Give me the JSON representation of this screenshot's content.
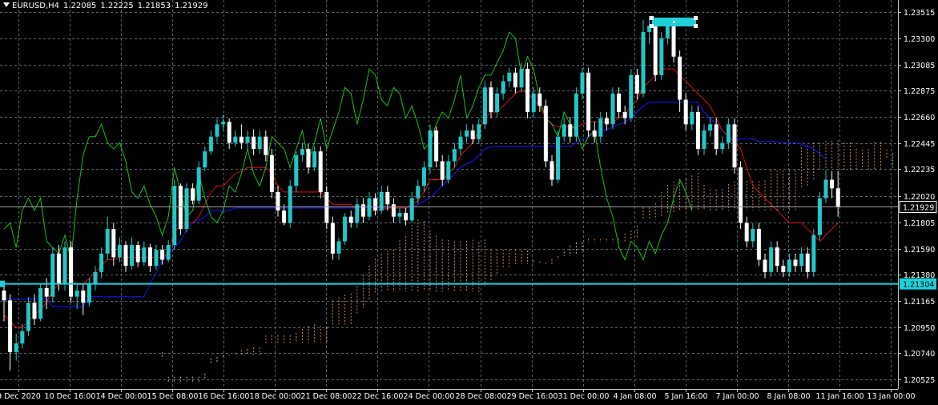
{
  "header": {
    "symbol": "EURUSD,H4",
    "open": "1.22085",
    "high": "1.22225",
    "low": "1.21853",
    "close": "1.21929"
  },
  "colors": {
    "background": "#000000",
    "grid": "#5a6670",
    "bull": "#22c8c8",
    "bear": "#ffffff",
    "tenkan": "#e01010",
    "kijun": "#1818ff",
    "chikou": "#19c419",
    "cloud_up": "#f4a460",
    "cloud_down": "#ded8c8",
    "hline": "#20d0d8",
    "price_line": "#a0a0a0"
  },
  "chart_data": {
    "type": "candlestick",
    "symbol": "EURUSD",
    "timeframe": "H4",
    "ylim": [
      1.2045,
      1.2361
    ],
    "y_ticks": [
      "1.23515",
      "1.23300",
      "1.23085",
      "1.22875",
      "1.22660",
      "1.22445",
      "1.22235",
      "1.22020",
      "1.21805",
      "1.21590",
      "1.21380",
      "1.21165",
      "1.20950",
      "1.20740",
      "1.20525"
    ],
    "x_ticks": [
      "9 Dec 2020",
      "10 Dec 16:00",
      "14 Dec 00:00",
      "15 Dec 08:00",
      "16 Dec 16:00",
      "18 Dec 00:00",
      "21 Dec 08:00",
      "22 Dec 16:00",
      "24 Dec 00:00",
      "28 Dec 08:00",
      "29 Dec 16:00",
      "31 Dec 00:00",
      "4 Jan 08:00",
      "5 Jan 16:00",
      "7 Jan 00:00",
      "8 Jan 08:00",
      "11 Jan 16:00",
      "13 Jan 00:00"
    ],
    "price_label": "1.21929",
    "hline_label": "1.21304",
    "hline_value": 1.21304,
    "current_price": 1.21929,
    "candles": [
      [
        1.2125,
        1.2117,
        1.213,
        1.21
      ],
      [
        1.2117,
        1.2075,
        1.2122,
        1.206
      ],
      [
        1.2075,
        1.2082,
        1.209,
        1.2068
      ],
      [
        1.2082,
        1.2092,
        1.2098,
        1.2078
      ],
      [
        1.2092,
        1.2115,
        1.212,
        1.2088
      ],
      [
        1.2115,
        1.2102,
        1.2122,
        1.2097
      ],
      [
        1.2102,
        1.2127,
        1.213,
        1.21
      ],
      [
        1.2127,
        1.212,
        1.2135,
        1.211
      ],
      [
        1.212,
        1.2155,
        1.216,
        1.2115
      ],
      [
        1.2155,
        1.213,
        1.2162,
        1.2125
      ],
      [
        1.213,
        1.216,
        1.2165,
        1.2125
      ],
      [
        1.216,
        1.212,
        1.2165,
        1.2115
      ],
      [
        1.212,
        1.2125,
        1.213,
        1.211
      ],
      [
        1.2125,
        1.2115,
        1.213,
        1.2105
      ],
      [
        1.2115,
        1.213,
        1.2135,
        1.2112
      ],
      [
        1.213,
        1.214,
        1.2145,
        1.2125
      ],
      [
        1.214,
        1.2155,
        1.216,
        1.2135
      ],
      [
        1.2155,
        1.2175,
        1.2185,
        1.215
      ],
      [
        1.2175,
        1.2152,
        1.218,
        1.2145
      ],
      [
        1.2152,
        1.2162,
        1.2168,
        1.2148
      ],
      [
        1.2162,
        1.2145,
        1.2165,
        1.214
      ],
      [
        1.2145,
        1.2162,
        1.2168,
        1.2142
      ],
      [
        1.2162,
        1.2148,
        1.2165,
        1.2144
      ],
      [
        1.2148,
        1.216,
        1.2165,
        1.2145
      ],
      [
        1.216,
        1.2145,
        1.2163,
        1.214
      ],
      [
        1.2145,
        1.2158,
        1.2162,
        1.2142
      ],
      [
        1.2158,
        1.215,
        1.2162,
        1.2146
      ],
      [
        1.215,
        1.2162,
        1.2166,
        1.2148
      ],
      [
        1.2162,
        1.221,
        1.2215,
        1.2158
      ],
      [
        1.221,
        1.2175,
        1.2212,
        1.217
      ],
      [
        1.2175,
        1.2208,
        1.2212,
        1.2172
      ],
      [
        1.2208,
        1.2198,
        1.2212,
        1.2195
      ],
      [
        1.2198,
        1.2225,
        1.223,
        1.2195
      ],
      [
        1.2225,
        1.2238,
        1.2242,
        1.2222
      ],
      [
        1.2238,
        1.225,
        1.2255,
        1.2235
      ],
      [
        1.225,
        1.226,
        1.2265,
        1.2245
      ],
      [
        1.226,
        1.2262,
        1.2268,
        1.2255
      ],
      [
        1.2262,
        1.2245,
        1.2265,
        1.224
      ],
      [
        1.2245,
        1.225,
        1.2255,
        1.2242
      ],
      [
        1.225,
        1.2245,
        1.226,
        1.224
      ],
      [
        1.2245,
        1.225,
        1.2255,
        1.224
      ],
      [
        1.225,
        1.224,
        1.2256,
        1.2235
      ],
      [
        1.224,
        1.225,
        1.2255,
        1.2236
      ],
      [
        1.225,
        1.2235,
        1.2255,
        1.223
      ],
      [
        1.2235,
        1.2205,
        1.224,
        1.22
      ],
      [
        1.2205,
        1.219,
        1.221,
        1.2185
      ],
      [
        1.219,
        1.218,
        1.2195,
        1.2178
      ],
      [
        1.218,
        1.221,
        1.2215,
        1.2176
      ],
      [
        1.221,
        1.2235,
        1.2238,
        1.2205
      ],
      [
        1.2235,
        1.224,
        1.2245,
        1.223
      ],
      [
        1.224,
        1.2225,
        1.2244,
        1.222
      ],
      [
        1.2225,
        1.2238,
        1.2242,
        1.2222
      ],
      [
        1.2238,
        1.2205,
        1.2242,
        1.22
      ],
      [
        1.2205,
        1.218,
        1.221,
        1.2175
      ],
      [
        1.218,
        1.2155,
        1.2185,
        1.215
      ],
      [
        1.2155,
        1.2165,
        1.2168,
        1.215
      ],
      [
        1.2165,
        1.2185,
        1.2188,
        1.2162
      ],
      [
        1.2185,
        1.218,
        1.219,
        1.2176
      ],
      [
        1.218,
        1.2195,
        1.22,
        1.2176
      ],
      [
        1.2195,
        1.2185,
        1.22,
        1.218
      ],
      [
        1.2185,
        1.22,
        1.2205,
        1.2182
      ],
      [
        1.22,
        1.219,
        1.2204,
        1.2186
      ],
      [
        1.219,
        1.2205,
        1.221,
        1.2187
      ],
      [
        1.2205,
        1.2195,
        1.221,
        1.219
      ],
      [
        1.2195,
        1.2185,
        1.22,
        1.218
      ],
      [
        1.2185,
        1.2188,
        1.2192,
        1.218
      ],
      [
        1.2188,
        1.2182,
        1.2192,
        1.2178
      ],
      [
        1.2182,
        1.22,
        1.2205,
        1.218
      ],
      [
        1.22,
        1.221,
        1.2215,
        1.2196
      ],
      [
        1.221,
        1.2225,
        1.223,
        1.2205
      ],
      [
        1.2225,
        1.2255,
        1.226,
        1.222
      ],
      [
        1.2255,
        1.223,
        1.2258,
        1.2225
      ],
      [
        1.223,
        1.2215,
        1.2235,
        1.221
      ],
      [
        1.2215,
        1.223,
        1.2235,
        1.2212
      ],
      [
        1.223,
        1.224,
        1.2245,
        1.2225
      ],
      [
        1.224,
        1.225,
        1.2255,
        1.2235
      ],
      [
        1.225,
        1.2255,
        1.226,
        1.2245
      ],
      [
        1.2255,
        1.2248,
        1.226,
        1.2244
      ],
      [
        1.2248,
        1.226,
        1.2265,
        1.2244
      ],
      [
        1.226,
        1.229,
        1.2295,
        1.2256
      ],
      [
        1.229,
        1.227,
        1.2295,
        1.2265
      ],
      [
        1.227,
        1.2285,
        1.229,
        1.2266
      ],
      [
        1.2285,
        1.2295,
        1.23,
        1.228
      ],
      [
        1.2295,
        1.2302,
        1.2306,
        1.229
      ],
      [
        1.2302,
        1.229,
        1.2306,
        1.2285
      ],
      [
        1.229,
        1.2305,
        1.231,
        1.2286
      ],
      [
        1.2305,
        1.227,
        1.231,
        1.2265
      ],
      [
        1.227,
        1.2285,
        1.229,
        1.2266
      ],
      [
        1.2285,
        1.2275,
        1.229,
        1.227
      ],
      [
        1.2275,
        1.223,
        1.228,
        1.2225
      ],
      [
        1.223,
        1.2215,
        1.2235,
        1.221
      ],
      [
        1.2215,
        1.225,
        1.2255,
        1.2212
      ],
      [
        1.225,
        1.226,
        1.2265,
        1.2246
      ],
      [
        1.226,
        1.225,
        1.2266,
        1.2245
      ],
      [
        1.225,
        1.2285,
        1.229,
        1.2246
      ],
      [
        1.2285,
        1.2302,
        1.2306,
        1.228
      ],
      [
        1.2302,
        1.2255,
        1.2306,
        1.225
      ],
      [
        1.2255,
        1.225,
        1.2262,
        1.2245
      ],
      [
        1.225,
        1.2265,
        1.227,
        1.2245
      ],
      [
        1.2265,
        1.226,
        1.227,
        1.2255
      ],
      [
        1.226,
        1.2285,
        1.229,
        1.2256
      ],
      [
        1.2285,
        1.227,
        1.229,
        1.2265
      ],
      [
        1.227,
        1.2265,
        1.2275,
        1.226
      ],
      [
        1.2265,
        1.23,
        1.2305,
        1.2262
      ],
      [
        1.23,
        1.2285,
        1.2305,
        1.228
      ],
      [
        1.2285,
        1.2335,
        1.2345,
        1.2282
      ],
      [
        1.2335,
        1.234,
        1.2348,
        1.2325
      ],
      [
        1.234,
        1.23,
        1.2345,
        1.2295
      ],
      [
        1.23,
        1.233,
        1.2335,
        1.2296
      ],
      [
        1.233,
        1.234,
        1.2345,
        1.2325
      ],
      [
        1.234,
        1.2315,
        1.2345,
        1.231
      ],
      [
        1.2315,
        1.228,
        1.232,
        1.227
      ],
      [
        1.228,
        1.226,
        1.2285,
        1.2255
      ],
      [
        1.226,
        1.227,
        1.2275,
        1.2255
      ],
      [
        1.227,
        1.224,
        1.2275,
        1.2235
      ],
      [
        1.224,
        1.2255,
        1.226,
        1.2235
      ],
      [
        1.2255,
        1.226,
        1.2266,
        1.225
      ],
      [
        1.226,
        1.224,
        1.2265,
        1.2235
      ],
      [
        1.224,
        1.2245,
        1.225,
        1.2236
      ],
      [
        1.2245,
        1.226,
        1.2265,
        1.224
      ],
      [
        1.226,
        1.2225,
        1.2265,
        1.222
      ],
      [
        1.2225,
        1.218,
        1.223,
        1.2175
      ],
      [
        1.218,
        1.2165,
        1.2185,
        1.216
      ],
      [
        1.2165,
        1.2175,
        1.218,
        1.216
      ],
      [
        1.2175,
        1.215,
        1.218,
        1.2145
      ],
      [
        1.215,
        1.214,
        1.2155,
        1.2135
      ],
      [
        1.214,
        1.216,
        1.2165,
        1.2136
      ],
      [
        1.216,
        1.2145,
        1.2165,
        1.214
      ],
      [
        1.2145,
        1.214,
        1.215,
        1.2136
      ],
      [
        1.214,
        1.215,
        1.2155,
        1.2136
      ],
      [
        1.215,
        1.2145,
        1.2155,
        1.214
      ],
      [
        1.2145,
        1.2155,
        1.216,
        1.214
      ],
      [
        1.2155,
        1.214,
        1.216,
        1.2135
      ],
      [
        1.214,
        1.217,
        1.2175,
        1.2136
      ],
      [
        1.217,
        1.22,
        1.2205,
        1.2166
      ],
      [
        1.22,
        1.2215,
        1.2222,
        1.2196
      ],
      [
        1.2215,
        1.2208,
        1.2222,
        1.22
      ],
      [
        1.2208,
        1.2193,
        1.2222,
        1.2185
      ]
    ],
    "tenkan": [
      1.2105,
      1.21,
      1.2095,
      1.2095,
      1.21,
      1.2105,
      1.211,
      1.2115,
      1.2125,
      1.213,
      1.2135,
      1.2135,
      1.213,
      1.213,
      1.2135,
      1.214,
      1.2145,
      1.215,
      1.215,
      1.2152,
      1.2152,
      1.2152,
      1.2152,
      1.2152,
      1.2152,
      1.2152,
      1.2152,
      1.2155,
      1.2175,
      1.2175,
      1.218,
      1.218,
      1.2185,
      1.2195,
      1.2205,
      1.221,
      1.221,
      1.2215,
      1.222,
      1.2222,
      1.2225,
      1.2225,
      1.2225,
      1.2225,
      1.222,
      1.221,
      1.2205,
      1.2205,
      1.2205,
      1.2205,
      1.2205,
      1.2205,
      1.2205,
      1.22,
      1.2195,
      1.2195,
      1.2195,
      1.2195,
      1.219,
      1.219,
      1.219,
      1.219,
      1.219,
      1.2192,
      1.2192,
      1.2192,
      1.2192,
      1.2195,
      1.2198,
      1.2205,
      1.2215,
      1.2215,
      1.2215,
      1.222,
      1.2225,
      1.2235,
      1.224,
      1.2245,
      1.2255,
      1.2265,
      1.227,
      1.227,
      1.2275,
      1.228,
      1.2285,
      1.2288,
      1.2285,
      1.228,
      1.2275,
      1.2265,
      1.226,
      1.2258,
      1.2258,
      1.2258,
      1.2258,
      1.226,
      1.2262,
      1.2262,
      1.2262,
      1.2262,
      1.2262,
      1.2265,
      1.2268,
      1.2275,
      1.228,
      1.229,
      1.2295,
      1.23,
      1.2305,
      1.2305,
      1.2305,
      1.23,
      1.2295,
      1.229,
      1.2285,
      1.228,
      1.2275,
      1.2265,
      1.2255,
      1.225,
      1.2245,
      1.224,
      1.2225,
      1.221,
      1.2205,
      1.22,
      1.2195,
      1.219,
      1.2185,
      1.218,
      1.218,
      1.218,
      1.2175,
      1.217,
      1.2165,
      1.217,
      1.2175,
      1.218
    ],
    "kijun": [
      1.2118,
      1.2118,
      1.2118,
      1.2118,
      1.2118,
      1.2118,
      1.2118,
      1.2118,
      1.2112,
      1.2112,
      1.2112,
      1.2112,
      1.2112,
      1.2112,
      1.212,
      1.212,
      1.212,
      1.212,
      1.212,
      1.212,
      1.212,
      1.212,
      1.212,
      1.212,
      1.213,
      1.214,
      1.215,
      1.2155,
      1.216,
      1.2165,
      1.2175,
      1.218,
      1.2182,
      1.2185,
      1.219,
      1.219,
      1.219,
      1.219,
      1.2192,
      1.2192,
      1.2192,
      1.2192,
      1.2192,
      1.2192,
      1.2192,
      1.2192,
      1.2192,
      1.2192,
      1.2192,
      1.2192,
      1.2192,
      1.2192,
      1.2192,
      1.2192,
      1.2192,
      1.2192,
      1.2192,
      1.2192,
      1.2192,
      1.2192,
      1.2192,
      1.2192,
      1.2192,
      1.2192,
      1.2192,
      1.2192,
      1.2192,
      1.2192,
      1.2195,
      1.2198,
      1.22,
      1.2205,
      1.221,
      1.2215,
      1.222,
      1.2225,
      1.2228,
      1.223,
      1.2235,
      1.224,
      1.2242,
      1.2242,
      1.2242,
      1.2242,
      1.2242,
      1.2242,
      1.2242,
      1.2242,
      1.2242,
      1.2242,
      1.2242,
      1.2242,
      1.2242,
      1.2242,
      1.2245,
      1.2248,
      1.225,
      1.2252,
      1.2255,
      1.2255,
      1.2258,
      1.226,
      1.2262,
      1.2265,
      1.227,
      1.2275,
      1.2278,
      1.2278,
      1.2278,
      1.2278,
      1.2278,
      1.2278,
      1.2278,
      1.2278,
      1.2278,
      1.227,
      1.2265,
      1.226,
      1.2255,
      1.225,
      1.2248,
      1.2248,
      1.2248,
      1.2248,
      1.2246,
      1.2246,
      1.2246,
      1.2246,
      1.2245,
      1.2245,
      1.2245,
      1.2244,
      1.2242,
      1.224,
      1.2236,
      1.2232
    ],
    "chikou": [
      1.2175,
      1.218,
      1.216,
      1.219,
      1.22,
      1.219,
      1.22,
      1.2165,
      1.216,
      1.2155,
      1.217,
      1.215,
      1.22,
      1.2235,
      1.225,
      1.225,
      1.226,
      1.2245,
      1.224,
      1.2245,
      1.223,
      1.2205,
      1.22,
      1.221,
      1.2195,
      1.2185,
      1.217,
      1.2185,
      1.2225,
      1.2205,
      1.2185,
      1.219,
      1.222,
      1.22,
      1.2185,
      1.218,
      1.219,
      1.221,
      1.2205,
      1.222,
      1.224,
      1.222,
      1.221,
      1.2225,
      1.225,
      1.2245,
      1.224,
      1.2225,
      1.224,
      1.2255,
      1.223,
      1.2245,
      1.2265,
      1.224,
      1.2255,
      1.227,
      1.229,
      1.2285,
      1.226,
      1.228,
      1.2305,
      1.23,
      1.228,
      1.2275,
      1.229,
      1.2285,
      1.2265,
      1.2275,
      1.226,
      1.224,
      1.2245,
      1.226,
      1.227,
      1.2265,
      1.228,
      1.23,
      1.2265,
      1.2275,
      1.229,
      1.23,
      1.23,
      1.231,
      1.232,
      1.2335,
      1.233,
      1.23,
      1.2315,
      1.2305,
      1.228,
      1.2265,
      1.226,
      1.225,
      1.227,
      1.226,
      1.2255,
      1.224,
      1.225,
      1.2255,
      1.2225,
      1.22,
      1.2185,
      1.216,
      1.215,
      1.2165,
      1.216,
      1.215,
      1.2165,
      1.2155,
      1.217,
      1.218,
      1.22,
      1.2215,
      1.2205,
      1.219
    ]
  }
}
